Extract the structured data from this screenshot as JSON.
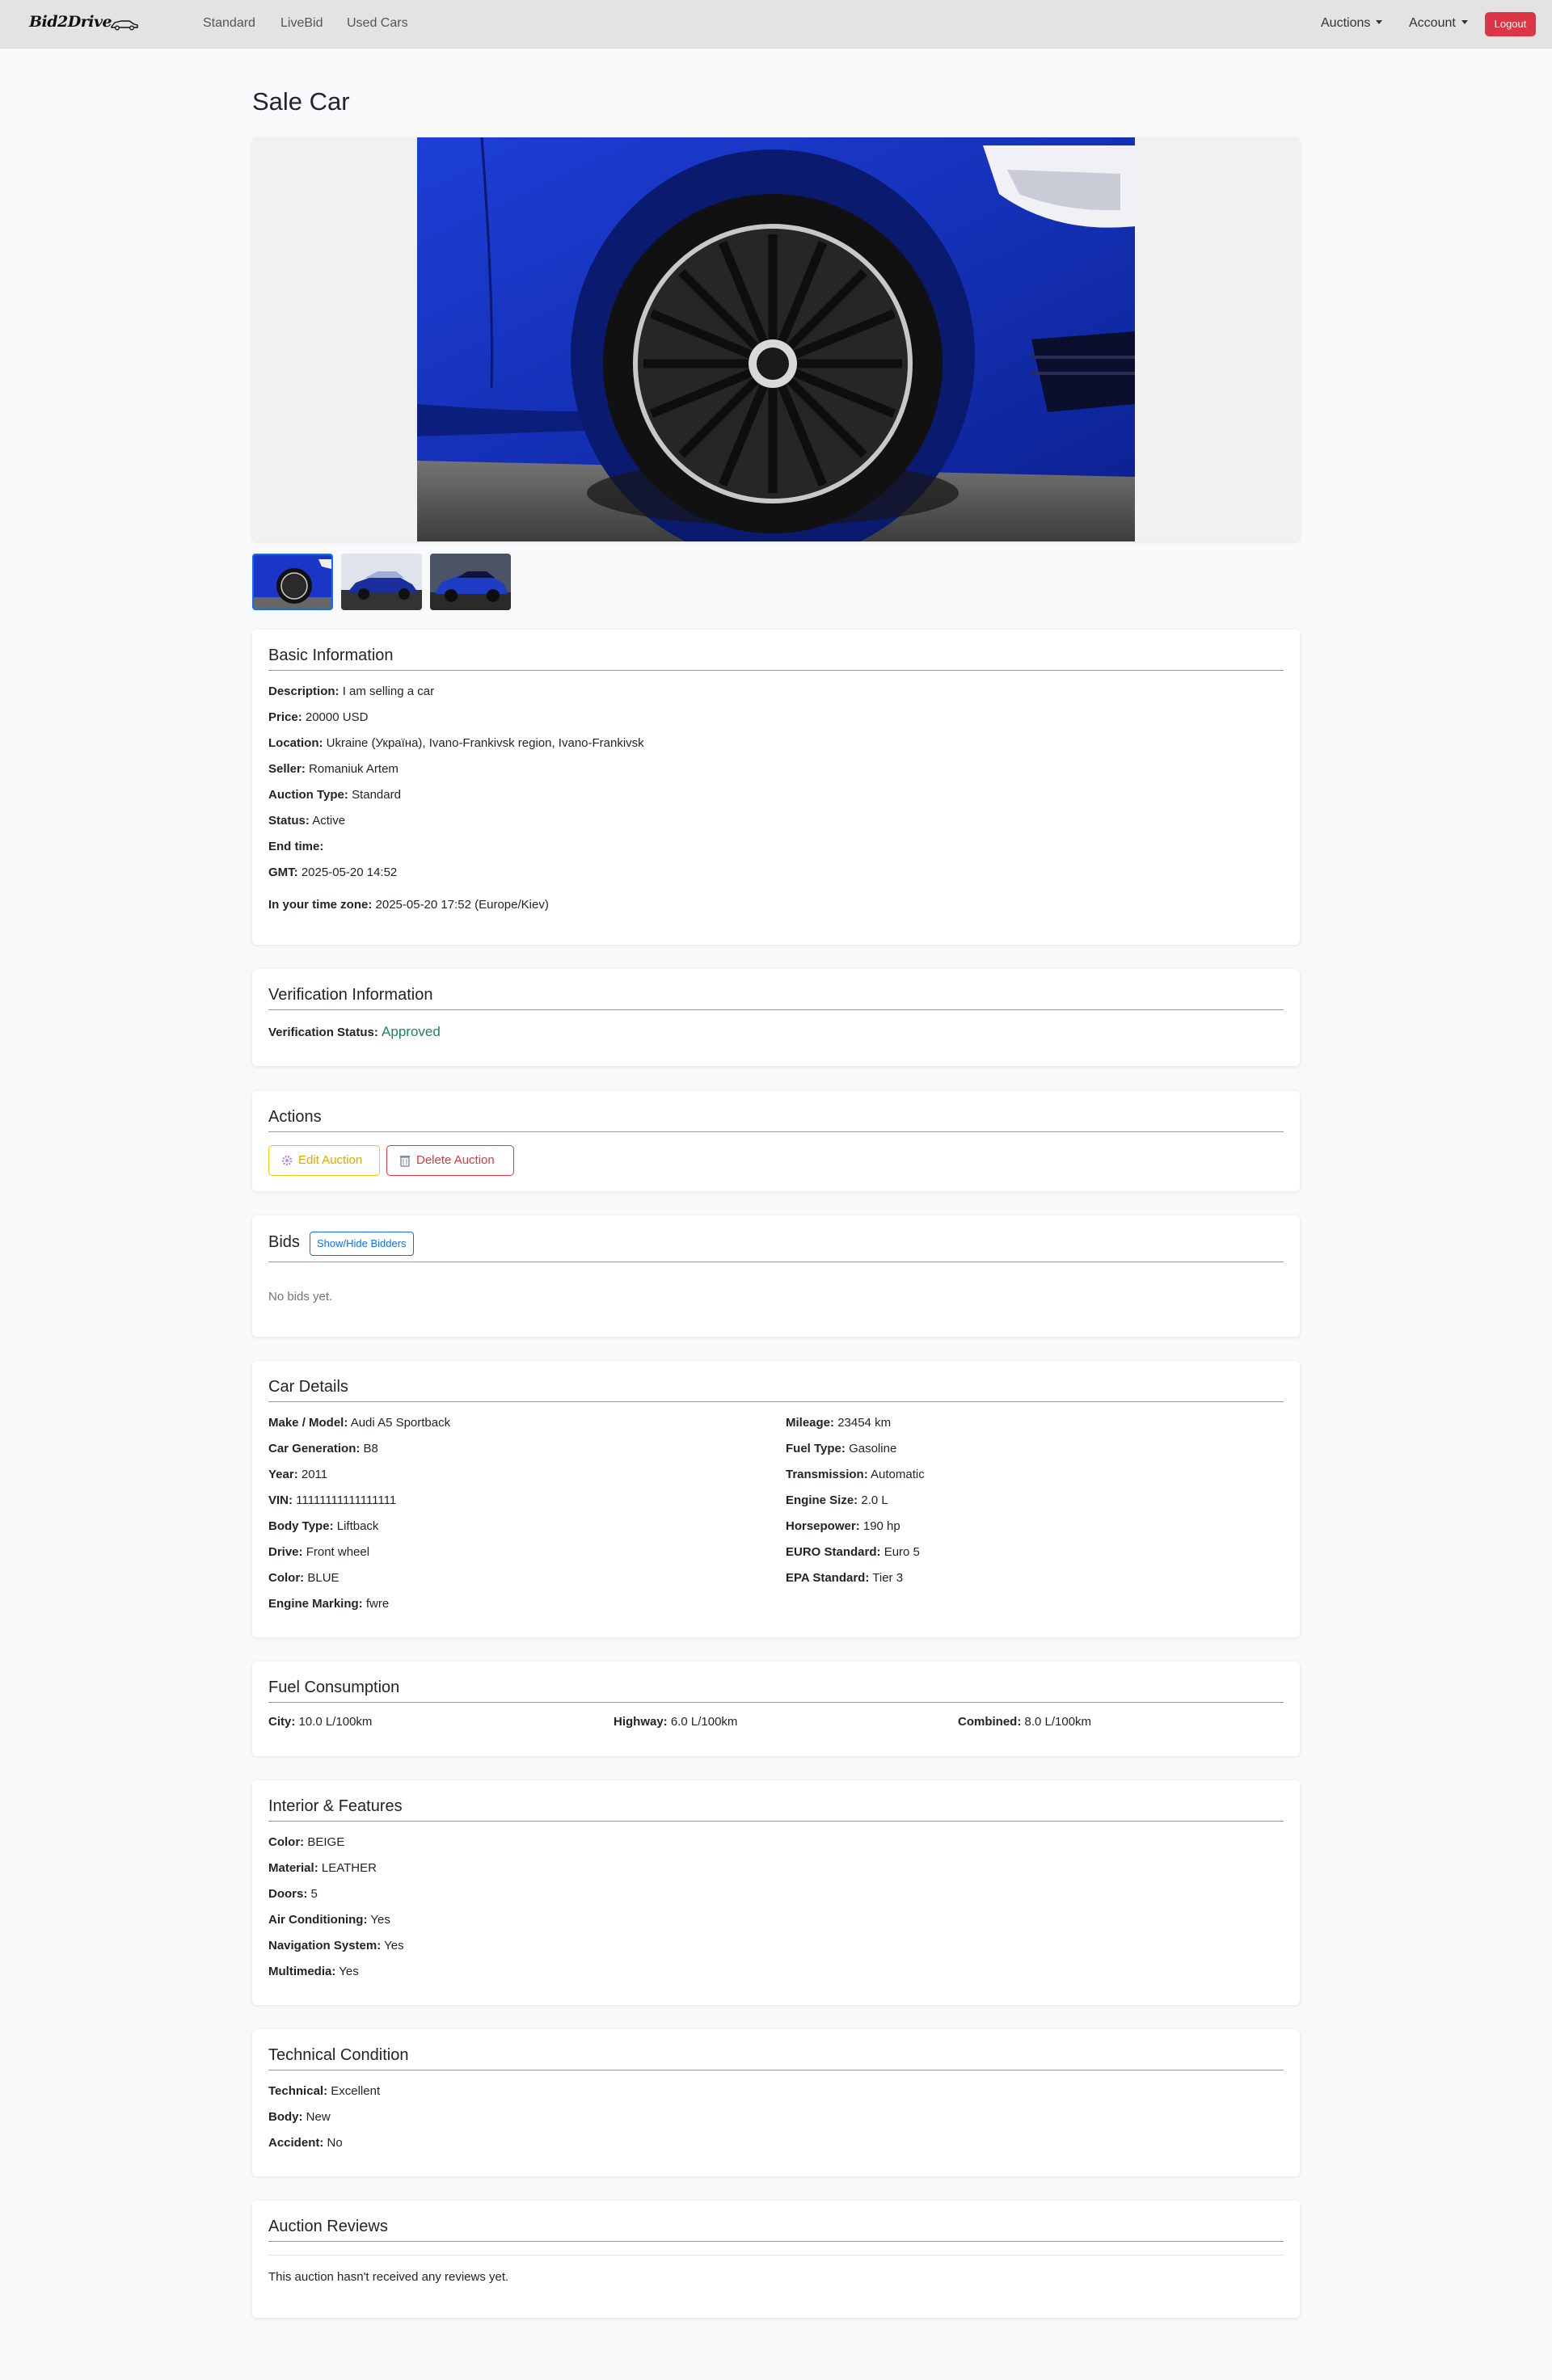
{
  "nav": {
    "brand": "Bid2Drive",
    "links": [
      "Standard",
      "LiveBid",
      "Used Cars"
    ],
    "auctions": "Auctions",
    "account": "Account",
    "logout": "Logout"
  },
  "page": {
    "title": "Sale Car"
  },
  "basic": {
    "title": "Basic Information",
    "description_label": "Description:",
    "description": "I am selling a car",
    "price_label": "Price:",
    "price": "20000 USD",
    "location_label": "Location:",
    "location": "Ukraine (Україна), Ivano-Frankivsk region, Ivano-Frankivsk",
    "seller_label": "Seller:",
    "seller": "Romaniuk Artem",
    "auction_type_label": "Auction Type:",
    "auction_type": "Standard",
    "status_label": "Status:",
    "status": "Active",
    "end_time_label": "End time:",
    "gmt_label": "GMT:",
    "gmt": "2025-05-20 14:52",
    "tz_label": "In your time zone:",
    "tz": "2025-05-20 17:52 (Europe/Kiev)"
  },
  "verification": {
    "title": "Verification Information",
    "status_label": "Verification Status:",
    "status": "Approved"
  },
  "actions": {
    "title": "Actions",
    "edit": "Edit Auction",
    "delete": "Delete Auction"
  },
  "bids": {
    "title": "Bids",
    "toggle": "Show/Hide Bidders",
    "empty": "No bids yet."
  },
  "car": {
    "title": "Car Details",
    "left": [
      {
        "label": "Make / Model:",
        "value": "Audi A5 Sportback"
      },
      {
        "label": "Car Generation:",
        "value": "B8"
      },
      {
        "label": "Year:",
        "value": "2011"
      },
      {
        "label": "VIN:",
        "value": "11111111111111111"
      },
      {
        "label": "Body Type:",
        "value": "Liftback"
      },
      {
        "label": "Drive:",
        "value": "Front wheel"
      },
      {
        "label": "Color:",
        "value": "BLUE"
      },
      {
        "label": "Engine Marking:",
        "value": "fwre"
      }
    ],
    "right": [
      {
        "label": "Mileage:",
        "value": "23454 km"
      },
      {
        "label": "Fuel Type:",
        "value": "Gasoline"
      },
      {
        "label": "Transmission:",
        "value": "Automatic"
      },
      {
        "label": "Engine Size:",
        "value": "2.0 L"
      },
      {
        "label": "Horsepower:",
        "value": "190 hp"
      },
      {
        "label": "EURO Standard:",
        "value": "Euro 5"
      },
      {
        "label": "EPA Standard:",
        "value": "Tier 3"
      }
    ]
  },
  "fuel": {
    "title": "Fuel Consumption",
    "city_label": "City:",
    "city": "10.0 L/100km",
    "highway_label": "Highway:",
    "highway": "6.0 L/100km",
    "combined_label": "Combined:",
    "combined": "8.0 L/100km"
  },
  "interior": {
    "title": "Interior & Features",
    "items": [
      {
        "label": "Color:",
        "value": "BEIGE"
      },
      {
        "label": "Material:",
        "value": "LEATHER"
      },
      {
        "label": "Doors:",
        "value": "5"
      },
      {
        "label": "Air Conditioning:",
        "value": "Yes"
      },
      {
        "label": "Navigation System:",
        "value": "Yes"
      },
      {
        "label": "Multimedia:",
        "value": "Yes"
      }
    ]
  },
  "technical": {
    "title": "Technical Condition",
    "items": [
      {
        "label": "Technical:",
        "value": "Excellent"
      },
      {
        "label": "Body:",
        "value": "New"
      },
      {
        "label": "Accident:",
        "value": "No"
      }
    ]
  },
  "reviews": {
    "title": "Auction Reviews",
    "empty": "This auction hasn't received any reviews yet."
  }
}
